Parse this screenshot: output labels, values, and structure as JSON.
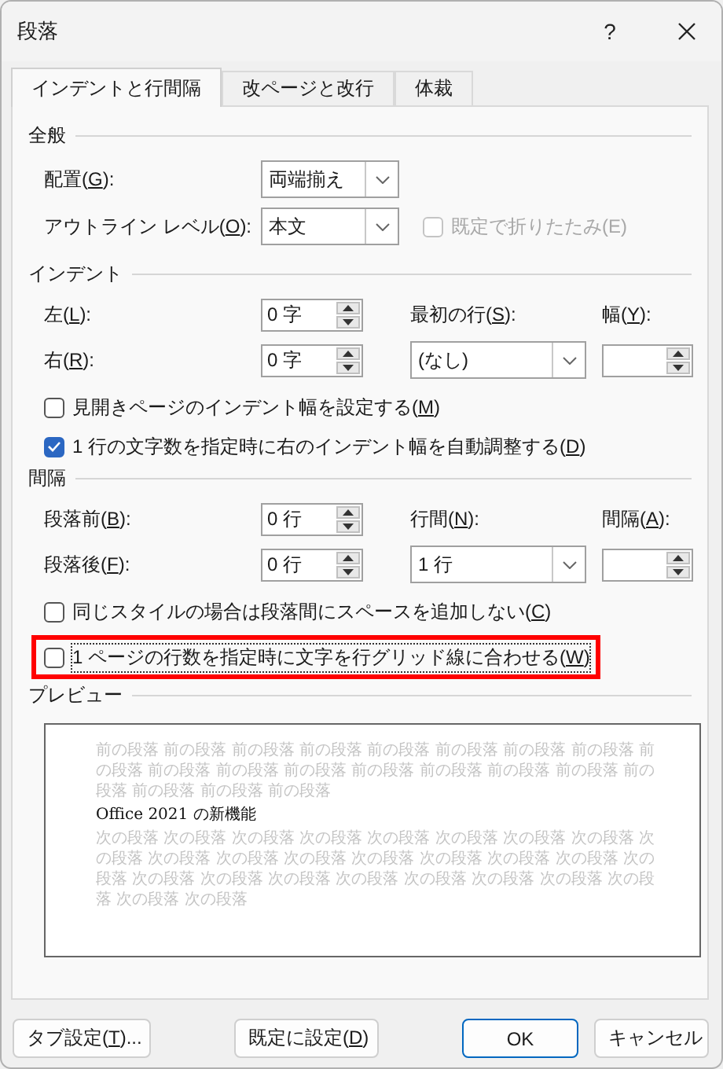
{
  "window": {
    "title": "段落",
    "help": "?"
  },
  "tabs": [
    {
      "label": "インデントと行間隔",
      "selected": true
    },
    {
      "label": "改ページと改行",
      "selected": false
    },
    {
      "label": "体裁",
      "selected": false
    }
  ],
  "general": {
    "heading": "全般",
    "rows": [
      {
        "cells": [
          {
            "kind": "label",
            "label": {
              "pre": "配置(",
              "key": "G",
              "post": "):"
            }
          },
          {
            "kind": "dropdown",
            "value": "両端揃え"
          }
        ]
      },
      {
        "cells": [
          {
            "kind": "label",
            "label": {
              "pre": "アウトライン レベル(",
              "key": "O",
              "post": "):"
            }
          },
          {
            "kind": "dropdown",
            "value": "本文"
          },
          {
            "kind": "checkbox",
            "label": "既定で折りたたみ(E)",
            "checked": false,
            "disabled": true
          }
        ]
      }
    ]
  },
  "indent": {
    "heading": "インデント",
    "rows": [
      {
        "cells": [
          {
            "kind": "label",
            "label": {
              "pre": "左(",
              "key": "L",
              "post": "):"
            }
          },
          {
            "kind": "spin",
            "value": "0 字"
          },
          {
            "kind": "label",
            "label": {
              "pre": "最初の行(",
              "key": "S",
              "post": "):"
            }
          },
          {
            "kind": "label",
            "label": {
              "pre": "幅(",
              "key": "Y",
              "post": "):"
            }
          }
        ]
      },
      {
        "cells": [
          {
            "kind": "label",
            "label": {
              "pre": "右(",
              "key": "R",
              "post": "):"
            }
          },
          {
            "kind": "spin",
            "value": "0 字"
          },
          {
            "kind": "dropdown",
            "value": "(なし)"
          },
          {
            "kind": "spin"
          }
        ]
      }
    ],
    "checkboxes": [
      {
        "label": {
          "pre": "見開きページのインデント幅を設定する(",
          "key": "M",
          "post": ")"
        },
        "checked": false,
        "focused": false,
        "highlighted": false
      },
      {
        "label": {
          "pre": "1 行の文字数を指定時に右のインデント幅を自動調整する(",
          "key": "D",
          "post": ")"
        },
        "checked": true,
        "focused": false,
        "highlighted": false
      }
    ]
  },
  "spacing": {
    "heading": "間隔",
    "rows": [
      {
        "cells": [
          {
            "kind": "label",
            "label": {
              "pre": "段落前(",
              "key": "B",
              "post": "):"
            }
          },
          {
            "kind": "spin",
            "value": "0 行"
          },
          {
            "kind": "label",
            "label": {
              "pre": "行間(",
              "key": "N",
              "post": "):"
            }
          },
          {
            "kind": "label",
            "label": {
              "pre": "間隔(",
              "key": "A",
              "post": "):"
            }
          }
        ]
      },
      {
        "cells": [
          {
            "kind": "label",
            "label": {
              "pre": "段落後(",
              "key": "F",
              "post": "):"
            }
          },
          {
            "kind": "spin",
            "value": "0 行"
          },
          {
            "kind": "dropdown",
            "value": "1 行"
          },
          {
            "kind": "spin"
          }
        ]
      }
    ],
    "checkboxes": [
      {
        "label": {
          "pre": "同じスタイルの場合は段落間にスペースを追加しない(",
          "key": "C",
          "post": ")"
        },
        "checked": false,
        "focused": false,
        "highlighted": false
      },
      {
        "label": {
          "pre": "1 ページの行数を指定時に文字を行グリッド線に合わせる(",
          "key": "W",
          "post": ")"
        },
        "checked": false,
        "focused": true,
        "highlighted": true
      }
    ]
  },
  "preview": {
    "heading": "プレビュー",
    "previous_text": "前の段落 前の段落 前の段落 前の段落 前の段落 前の段落 前の段落 前の段落 前の段落 前の段落 前の段落 前の段落 前の段落 前の段落 前の段落 前の段落 前の段落 前の段落 前の段落 前の段落",
    "sample_text": "Office 2021 の新機能",
    "next_text": "次の段落 次の段落 次の段落 次の段落 次の段落 次の段落 次の段落 次の段落 次の段落 次の段落 次の段落 次の段落 次の段落 次の段落 次の段落 次の段落 次の段落 次の段落 次の段落 次の段落 次の段落 次の段落 次の段落 次の段落 次の段落 次の段落 次の段落"
  },
  "buttons": [
    {
      "label": {
        "pre": "タブ設定(",
        "key": "T",
        "post": ")..."
      },
      "kind": "plain"
    },
    {
      "label": {
        "pre": "既定に設定(",
        "key": "D",
        "post": ")"
      },
      "kind": "plain"
    },
    {
      "label": "OK",
      "kind": "default"
    },
    {
      "label": "キャンセル",
      "kind": "plain"
    }
  ]
}
